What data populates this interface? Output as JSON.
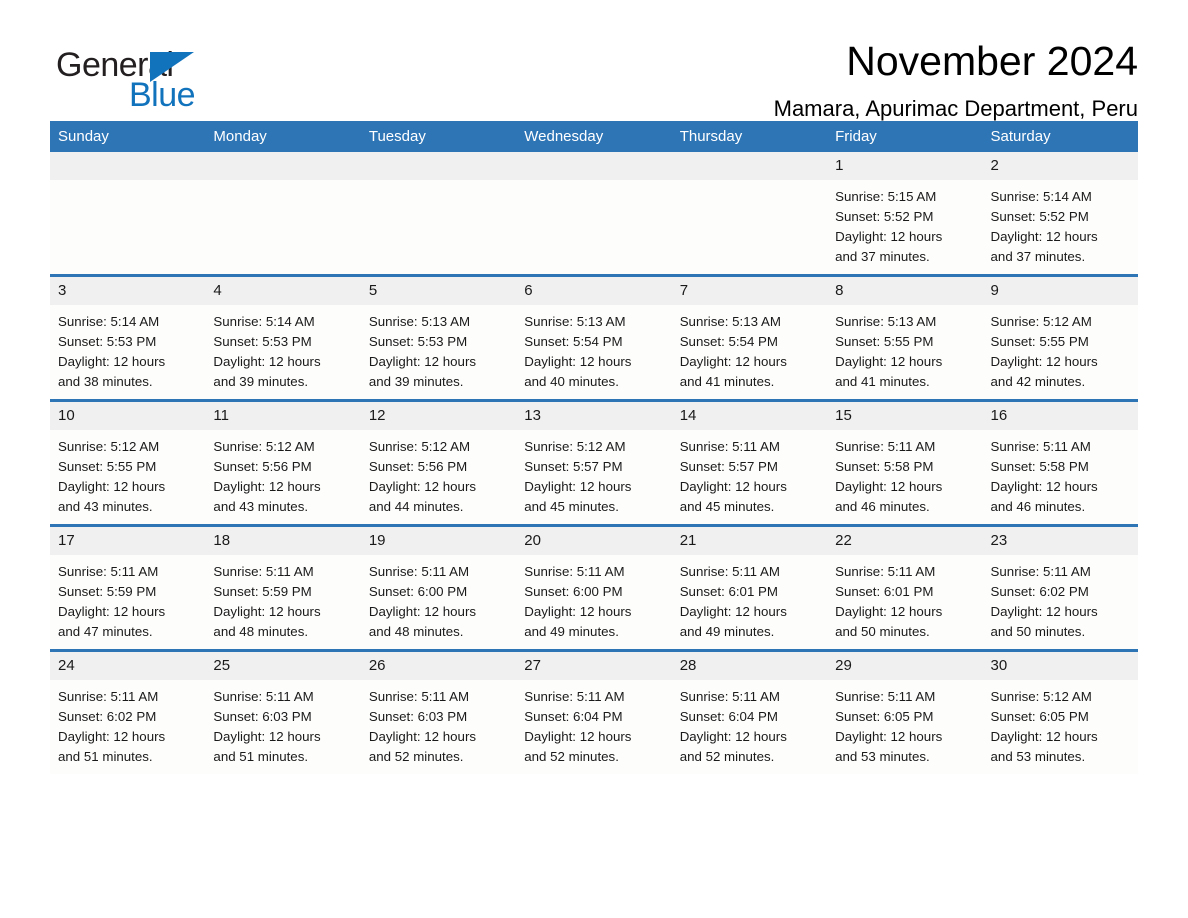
{
  "logo": {
    "word_one": "General",
    "word_two": "Blue",
    "accent_color": "#1273bd"
  },
  "header": {
    "title": "November 2024",
    "subtitle": "Mamara, Apurimac Department, Peru"
  },
  "theme": {
    "header_blue": "#2e75b6",
    "daynum_background": "#f0f0f0",
    "cell_background": "#fdfdfc"
  },
  "weekday_headers": [
    "Sunday",
    "Monday",
    "Tuesday",
    "Wednesday",
    "Thursday",
    "Friday",
    "Saturday"
  ],
  "weeks": [
    [
      {
        "day": "",
        "lines": []
      },
      {
        "day": "",
        "lines": []
      },
      {
        "day": "",
        "lines": []
      },
      {
        "day": "",
        "lines": []
      },
      {
        "day": "",
        "lines": []
      },
      {
        "day": "1",
        "lines": [
          "Sunrise: 5:15 AM",
          "Sunset: 5:52 PM",
          "Daylight: 12 hours",
          "and 37 minutes."
        ]
      },
      {
        "day": "2",
        "lines": [
          "Sunrise: 5:14 AM",
          "Sunset: 5:52 PM",
          "Daylight: 12 hours",
          "and 37 minutes."
        ]
      }
    ],
    [
      {
        "day": "3",
        "lines": [
          "Sunrise: 5:14 AM",
          "Sunset: 5:53 PM",
          "Daylight: 12 hours",
          "and 38 minutes."
        ]
      },
      {
        "day": "4",
        "lines": [
          "Sunrise: 5:14 AM",
          "Sunset: 5:53 PM",
          "Daylight: 12 hours",
          "and 39 minutes."
        ]
      },
      {
        "day": "5",
        "lines": [
          "Sunrise: 5:13 AM",
          "Sunset: 5:53 PM",
          "Daylight: 12 hours",
          "and 39 minutes."
        ]
      },
      {
        "day": "6",
        "lines": [
          "Sunrise: 5:13 AM",
          "Sunset: 5:54 PM",
          "Daylight: 12 hours",
          "and 40 minutes."
        ]
      },
      {
        "day": "7",
        "lines": [
          "Sunrise: 5:13 AM",
          "Sunset: 5:54 PM",
          "Daylight: 12 hours",
          "and 41 minutes."
        ]
      },
      {
        "day": "8",
        "lines": [
          "Sunrise: 5:13 AM",
          "Sunset: 5:55 PM",
          "Daylight: 12 hours",
          "and 41 minutes."
        ]
      },
      {
        "day": "9",
        "lines": [
          "Sunrise: 5:12 AM",
          "Sunset: 5:55 PM",
          "Daylight: 12 hours",
          "and 42 minutes."
        ]
      }
    ],
    [
      {
        "day": "10",
        "lines": [
          "Sunrise: 5:12 AM",
          "Sunset: 5:55 PM",
          "Daylight: 12 hours",
          "and 43 minutes."
        ]
      },
      {
        "day": "11",
        "lines": [
          "Sunrise: 5:12 AM",
          "Sunset: 5:56 PM",
          "Daylight: 12 hours",
          "and 43 minutes."
        ]
      },
      {
        "day": "12",
        "lines": [
          "Sunrise: 5:12 AM",
          "Sunset: 5:56 PM",
          "Daylight: 12 hours",
          "and 44 minutes."
        ]
      },
      {
        "day": "13",
        "lines": [
          "Sunrise: 5:12 AM",
          "Sunset: 5:57 PM",
          "Daylight: 12 hours",
          "and 45 minutes."
        ]
      },
      {
        "day": "14",
        "lines": [
          "Sunrise: 5:11 AM",
          "Sunset: 5:57 PM",
          "Daylight: 12 hours",
          "and 45 minutes."
        ]
      },
      {
        "day": "15",
        "lines": [
          "Sunrise: 5:11 AM",
          "Sunset: 5:58 PM",
          "Daylight: 12 hours",
          "and 46 minutes."
        ]
      },
      {
        "day": "16",
        "lines": [
          "Sunrise: 5:11 AM",
          "Sunset: 5:58 PM",
          "Daylight: 12 hours",
          "and 46 minutes."
        ]
      }
    ],
    [
      {
        "day": "17",
        "lines": [
          "Sunrise: 5:11 AM",
          "Sunset: 5:59 PM",
          "Daylight: 12 hours",
          "and 47 minutes."
        ]
      },
      {
        "day": "18",
        "lines": [
          "Sunrise: 5:11 AM",
          "Sunset: 5:59 PM",
          "Daylight: 12 hours",
          "and 48 minutes."
        ]
      },
      {
        "day": "19",
        "lines": [
          "Sunrise: 5:11 AM",
          "Sunset: 6:00 PM",
          "Daylight: 12 hours",
          "and 48 minutes."
        ]
      },
      {
        "day": "20",
        "lines": [
          "Sunrise: 5:11 AM",
          "Sunset: 6:00 PM",
          "Daylight: 12 hours",
          "and 49 minutes."
        ]
      },
      {
        "day": "21",
        "lines": [
          "Sunrise: 5:11 AM",
          "Sunset: 6:01 PM",
          "Daylight: 12 hours",
          "and 49 minutes."
        ]
      },
      {
        "day": "22",
        "lines": [
          "Sunrise: 5:11 AM",
          "Sunset: 6:01 PM",
          "Daylight: 12 hours",
          "and 50 minutes."
        ]
      },
      {
        "day": "23",
        "lines": [
          "Sunrise: 5:11 AM",
          "Sunset: 6:02 PM",
          "Daylight: 12 hours",
          "and 50 minutes."
        ]
      }
    ],
    [
      {
        "day": "24",
        "lines": [
          "Sunrise: 5:11 AM",
          "Sunset: 6:02 PM",
          "Daylight: 12 hours",
          "and 51 minutes."
        ]
      },
      {
        "day": "25",
        "lines": [
          "Sunrise: 5:11 AM",
          "Sunset: 6:03 PM",
          "Daylight: 12 hours",
          "and 51 minutes."
        ]
      },
      {
        "day": "26",
        "lines": [
          "Sunrise: 5:11 AM",
          "Sunset: 6:03 PM",
          "Daylight: 12 hours",
          "and 52 minutes."
        ]
      },
      {
        "day": "27",
        "lines": [
          "Sunrise: 5:11 AM",
          "Sunset: 6:04 PM",
          "Daylight: 12 hours",
          "and 52 minutes."
        ]
      },
      {
        "day": "28",
        "lines": [
          "Sunrise: 5:11 AM",
          "Sunset: 6:04 PM",
          "Daylight: 12 hours",
          "and 52 minutes."
        ]
      },
      {
        "day": "29",
        "lines": [
          "Sunrise: 5:11 AM",
          "Sunset: 6:05 PM",
          "Daylight: 12 hours",
          "and 53 minutes."
        ]
      },
      {
        "day": "30",
        "lines": [
          "Sunrise: 5:12 AM",
          "Sunset: 6:05 PM",
          "Daylight: 12 hours",
          "and 53 minutes."
        ]
      }
    ]
  ]
}
